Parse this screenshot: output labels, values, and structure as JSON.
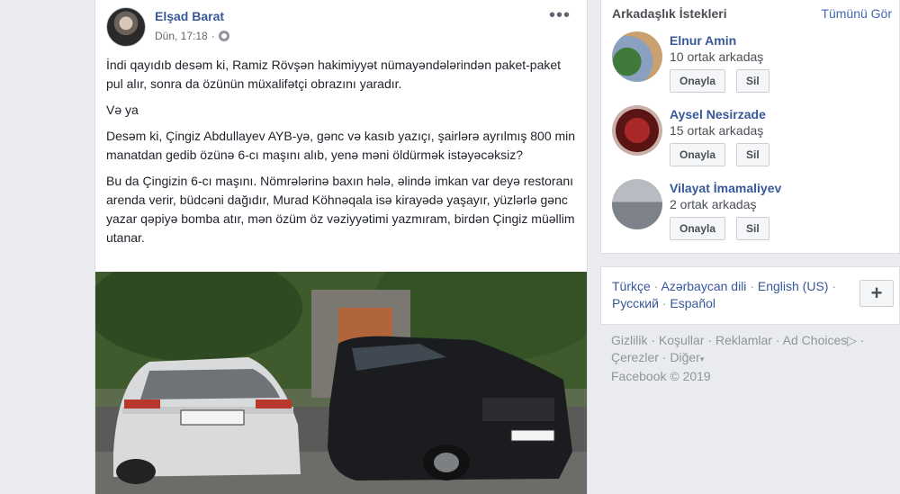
{
  "post": {
    "author": "Elşad Barat",
    "time": "Dün, 17:18",
    "dot": "·",
    "more": "•••",
    "paragraphs": [
      "İndi qayıdıb desəm ki, Ramiz Rövşən hakimiyyət nümayəndələrindən paket-paket pul alır, sonra da özünün müxalifətçi obrazını yaradır.",
      "Və ya",
      "Desəm ki, Çingiz Abdullayev AYB-yə, gənc və kasıb yazıçı, şairlərə ayrılmış 800 min manatdan gedib özünə 6-cı maşını alıb, yenə məni öldürmək istəyəcəksiz?",
      "Bu da Çingizin 6-cı maşını. Nömrələrinə baxın hələ, əlində imkan var deyə restoranı arenda verir, büdcəni dağıdır, Murad Köhnəqala isə kirayədə yaşayır, yüzlərlə gənc yazar qəpiyə bomba atır, mən özüm öz vəziyyətimi yazmıram, birdən Çingiz müəllim utanar."
    ],
    "plate_left": "99 AC 777",
    "plate_right": "10 AL 001"
  },
  "friend_requests": {
    "title": "Arkadaşlık İstekleri",
    "see_all": "Tümünü Gör",
    "confirm_label": "Onayla",
    "delete_label": "Sil",
    "items": [
      {
        "name": "Elnur Amin",
        "mutual": "10 ortak arkadaş"
      },
      {
        "name": "Aysel Nesirzade",
        "mutual": "15 ortak arkadaş"
      },
      {
        "name": "Vilayat İmamaliyev",
        "mutual": "2 ortak arkadaş"
      }
    ]
  },
  "languages": {
    "items": [
      "Türkçe",
      "Azərbaycan dili",
      "English (US)",
      "Русский",
      "Español"
    ],
    "separator": "·",
    "plus": "+"
  },
  "footer": {
    "links": [
      "Gizlilik",
      "Koşullar",
      "Reklamlar",
      "Ad Choices",
      "Çerezler",
      "Diğer"
    ],
    "copyright": "Facebook © 2019"
  },
  "colors": {
    "link": "#385898",
    "muted": "#90949c",
    "background": "#e9ebee"
  }
}
